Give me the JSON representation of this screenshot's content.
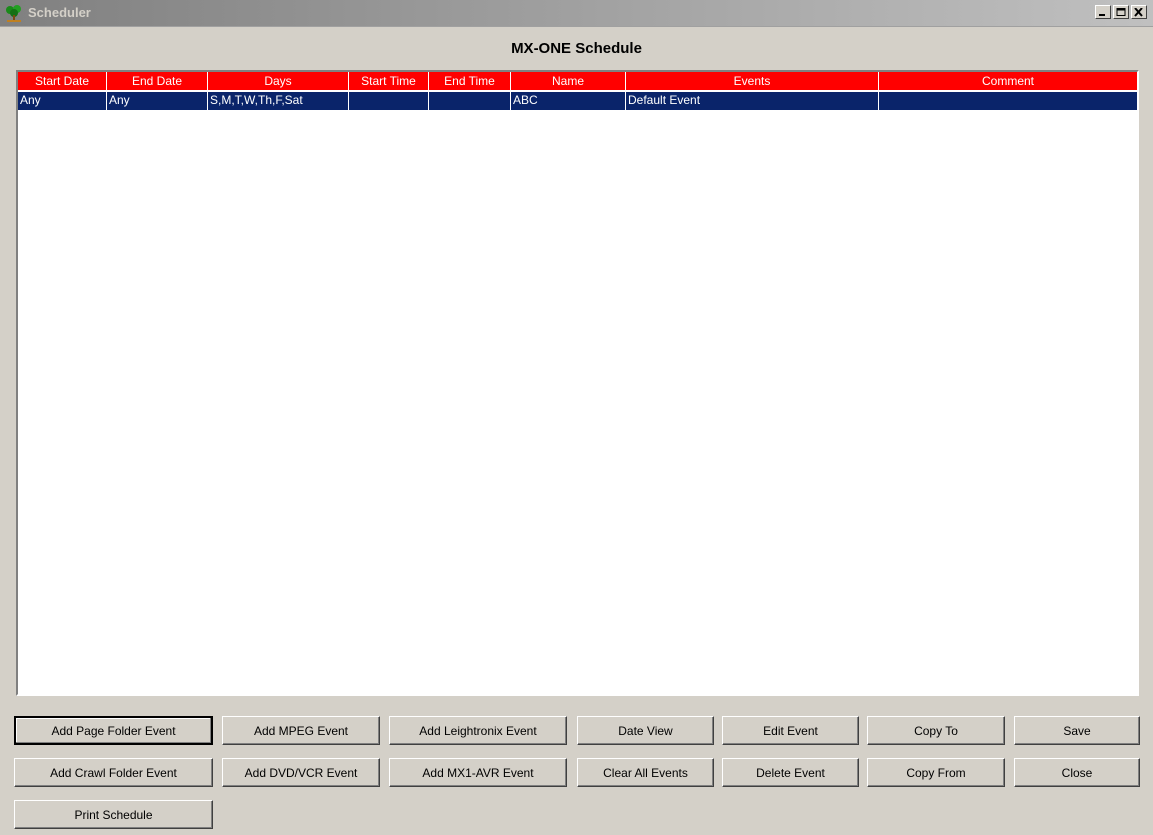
{
  "window": {
    "title": "Scheduler"
  },
  "heading": "MX-ONE Schedule",
  "table": {
    "columns": [
      "Start Date",
      "End Date",
      "Days",
      "Start Time",
      "End Time",
      "Name",
      "Events",
      "Comment"
    ],
    "rows": [
      [
        "Any",
        "Any",
        "S,M,T,W,Th,F,Sat",
        "",
        "",
        "ABC",
        "Default Event",
        ""
      ]
    ]
  },
  "buttons": {
    "add_page_folder_event": "Add Page Folder Event",
    "add_mpeg_event": "Add MPEG Event",
    "add_leightronix_event": "Add Leightronix Event",
    "date_view": "Date View",
    "edit_event": "Edit Event",
    "copy_to": "Copy To",
    "save": "Save",
    "add_crawl_folder_event": "Add Crawl Folder Event",
    "add_dvd_vcr_event": "Add DVD/VCR Event",
    "add_mx1_avr_event": "Add MX1-AVR Event",
    "clear_all_events": "Clear All Events",
    "delete_event": "Delete Event",
    "copy_from": "Copy From",
    "close": "Close",
    "print_schedule": "Print Schedule"
  },
  "colors": {
    "header_bg": "#ff0000",
    "selected_row_bg": "#0a246a",
    "window_bg": "#d4d0c8"
  },
  "icons": [
    "app-tree-icon",
    "minimize-icon",
    "maximize-icon",
    "close-icon"
  ]
}
